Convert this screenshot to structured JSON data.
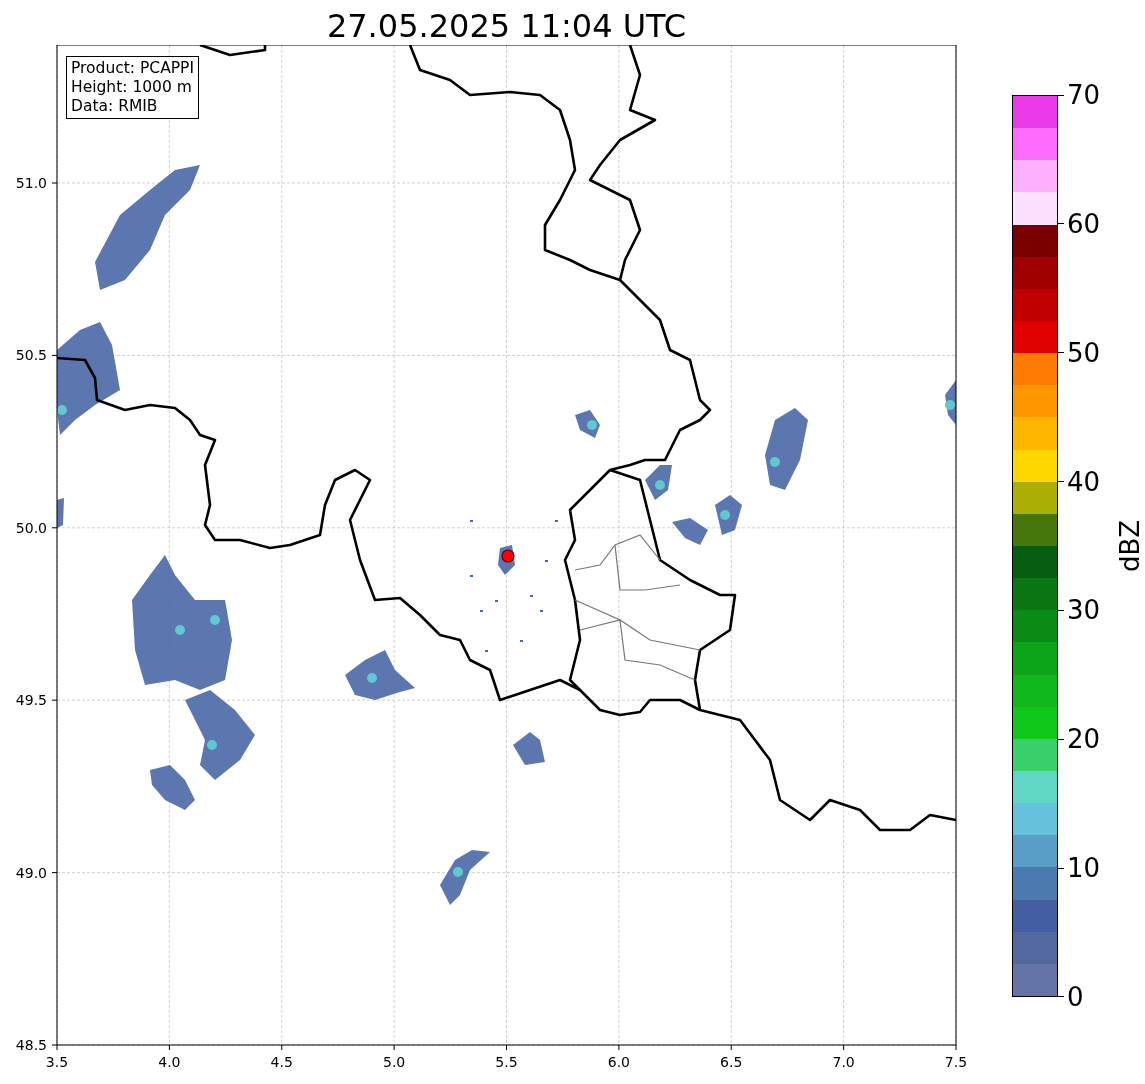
{
  "title": "27.05.2025 11:04 UTC",
  "info_box": [
    "Product: PCAPPI",
    "Height: 1000 m",
    "Data: RMIB"
  ],
  "map": {
    "xticks": [
      "3.5",
      "4.0",
      "4.5",
      "5.0",
      "5.5",
      "6.0",
      "6.5",
      "7.0",
      "7.5"
    ],
    "yticks": [
      "51.0",
      "50.5",
      "50.0",
      "49.5",
      "49.0",
      "48.5"
    ]
  },
  "colorbar": {
    "label": "dBZ",
    "ticks": [
      "70",
      "60",
      "50",
      "40",
      "30",
      "20",
      "10",
      "0"
    ],
    "bins": [
      {
        "color": "#6574a8"
      },
      {
        "color": "#52689f"
      },
      {
        "color": "#435ea1"
      },
      {
        "color": "#4a7ab0"
      },
      {
        "color": "#589ec7"
      },
      {
        "color": "#66c2dc"
      },
      {
        "color": "#60d6c4"
      },
      {
        "color": "#3ad16c"
      },
      {
        "color": "#10c81a"
      },
      {
        "color": "#10b81c"
      },
      {
        "color": "#0ea41a"
      },
      {
        "color": "#0c8a16"
      },
      {
        "color": "#0a7614"
      },
      {
        "color": "#085e10"
      },
      {
        "color": "#45770a"
      },
      {
        "color": "#acae06"
      },
      {
        "color": "#fed600"
      },
      {
        "color": "#feb600"
      },
      {
        "color": "#fe9600"
      },
      {
        "color": "#fe7a00"
      },
      {
        "color": "#e00000"
      },
      {
        "color": "#c00000"
      },
      {
        "color": "#a00000"
      },
      {
        "color": "#7a0000"
      },
      {
        "color": "#fde0fe"
      },
      {
        "color": "#feb0fe"
      },
      {
        "color": "#fd6cfd"
      },
      {
        "color": "#ea3aea"
      }
    ]
  }
}
